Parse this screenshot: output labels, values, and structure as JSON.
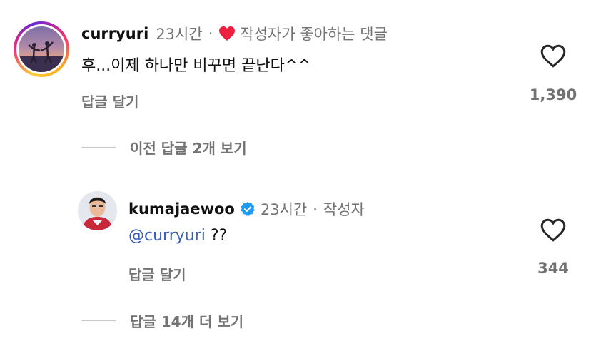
{
  "comment1": {
    "username": "curryuri",
    "time": "23시간",
    "dot": "·",
    "liked_by_author": "작성자가 좋아하는 댓글",
    "text": "후...이제 하나만 비꾸면 끝난다^^",
    "reply_label": "답글 달기",
    "like_count": "1,390",
    "view_previous_replies": "이전 답글 2개 보기"
  },
  "comment2": {
    "username": "kumajaewoo",
    "time": "23시간",
    "dot": "·",
    "author_badge": "작성자",
    "mention": "@curryuri",
    "text": " ??",
    "reply_label": "답글 달기",
    "like_count": "344",
    "view_more_replies": "답글 14개 더 보기"
  },
  "colors": {
    "heart_red": "#ed2040",
    "verified_blue": "#1d9bf0",
    "mention_blue": "#3b5fb8",
    "muted_gray": "#737373"
  },
  "icons": [
    "heart-filled-icon",
    "heart-outline-icon",
    "verified-badge-icon"
  ]
}
